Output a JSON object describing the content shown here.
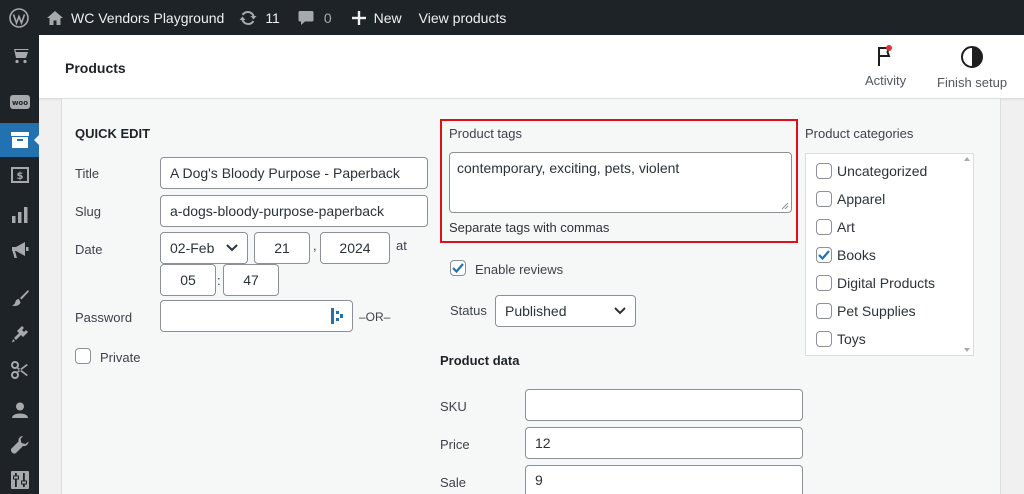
{
  "adminbar": {
    "site_name": "WC Vendors Playground",
    "updates_count": "11",
    "comments_count": "0",
    "new_label": "New",
    "view_label": "View products"
  },
  "header": {
    "title": "Products",
    "activity_label": "Activity",
    "finish_setup_label": "Finish setup"
  },
  "quick_edit": {
    "heading": "QUICK EDIT",
    "title_label": "Title",
    "title_value": "A Dog's Bloody Purpose - Paperback",
    "slug_label": "Slug",
    "slug_value": "a-dogs-bloody-purpose-paperback",
    "date_label": "Date",
    "date_month": "02-Feb",
    "date_day": "21",
    "date_sep": ",",
    "date_year": "2024",
    "at_label": "at",
    "hour": "05",
    "time_sep": ":",
    "minute": "47",
    "password_label": "Password",
    "password_value": "",
    "or_label": "–OR–",
    "private_label": "Private"
  },
  "tags": {
    "label": "Product tags",
    "value": "contemporary, exciting, pets, violent",
    "hint": "Separate tags with commas"
  },
  "enable_reviews_label": "Enable reviews",
  "status": {
    "label": "Status",
    "value": "Published"
  },
  "product_data": {
    "heading": "Product data",
    "sku_label": "SKU",
    "sku_value": "",
    "price_label": "Price",
    "price_value": "12",
    "sale_label": "Sale",
    "sale_value": "9"
  },
  "categories": {
    "label": "Product categories",
    "items": [
      {
        "label": "Uncategorized",
        "checked": false
      },
      {
        "label": "Apparel",
        "checked": false
      },
      {
        "label": "Art",
        "checked": false
      },
      {
        "label": "Books",
        "checked": true
      },
      {
        "label": "Digital Products",
        "checked": false
      },
      {
        "label": "Pet Supplies",
        "checked": false
      },
      {
        "label": "Toys",
        "checked": false
      }
    ]
  },
  "colors": {
    "admin_bar": "#1d2327",
    "accent": "#2271b1",
    "highlight_border": "#e0101a"
  }
}
